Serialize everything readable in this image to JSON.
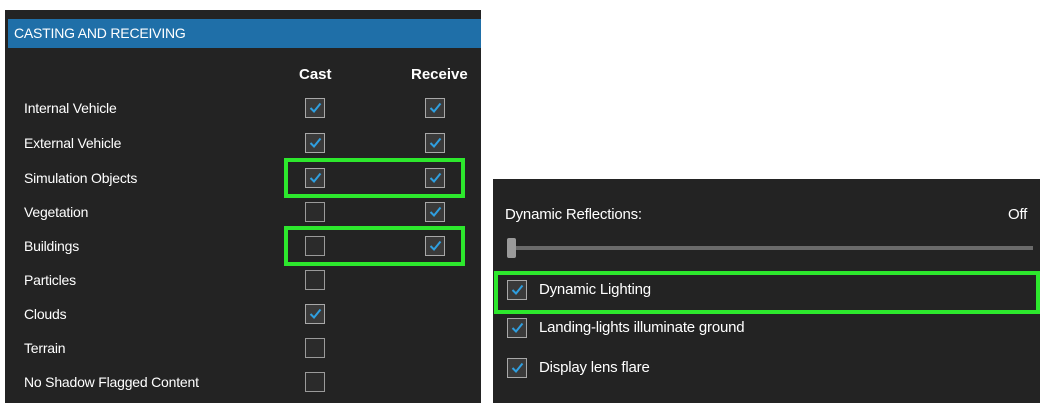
{
  "casting": {
    "header": "CASTING AND RECEIVING",
    "col_cast": "Cast",
    "col_receive": "Receive",
    "rows": [
      {
        "label": "Internal Vehicle",
        "cast": true,
        "receive": true
      },
      {
        "label": "External Vehicle",
        "cast": true,
        "receive": true
      },
      {
        "label": "Simulation Objects",
        "cast": true,
        "receive": true
      },
      {
        "label": "Vegetation",
        "cast": false,
        "receive": true
      },
      {
        "label": "Buildings",
        "cast": false,
        "receive": true
      },
      {
        "label": "Particles",
        "cast": false,
        "receive": null
      },
      {
        "label": "Clouds",
        "cast": true,
        "receive": null
      },
      {
        "label": "Terrain",
        "cast": false,
        "receive": null
      },
      {
        "label": "No Shadow Flagged Content",
        "cast": false,
        "receive": null
      }
    ]
  },
  "reflections": {
    "label": "Dynamic Reflections:",
    "value": "Off",
    "slider_fraction": 0
  },
  "options": [
    {
      "label": "Dynamic Lighting",
      "checked": true
    },
    {
      "label": "Landing-lights illuminate ground",
      "checked": true
    },
    {
      "label": "Display lens flare",
      "checked": true
    }
  ],
  "colors": {
    "header_bg": "#1f6fa8",
    "panel_bg": "#232323",
    "check_accent": "#2f9fe0",
    "highlight": "#2de82d"
  }
}
